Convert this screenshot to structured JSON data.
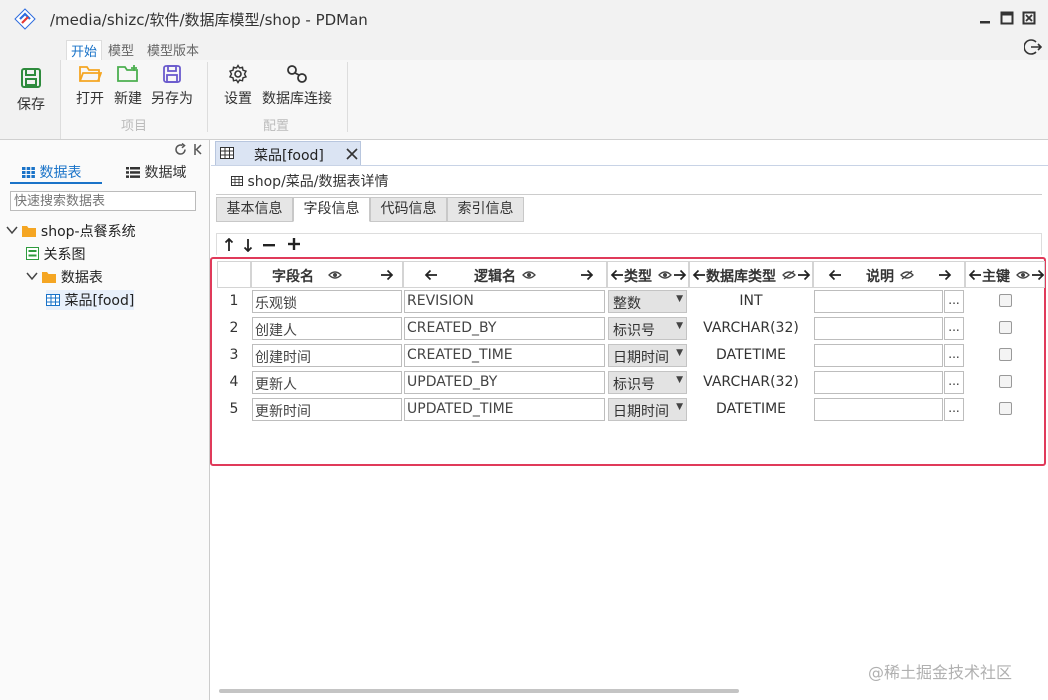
{
  "window": {
    "title": "/media/shizc/软件/数据库模型/shop - PDMan"
  },
  "ribbon": {
    "tabs": [
      "开始",
      "模型",
      "模型版本"
    ],
    "save_label": "保存",
    "open_label": "打开",
    "new_label": "新建",
    "saveas_label": "另存为",
    "project_group": "项目",
    "settings_label": "设置",
    "dbconn_label": "数据库连接",
    "config_group": "配置"
  },
  "sidebar": {
    "tab_tables": "数据表",
    "tab_domains": "数据域",
    "search_placeholder": "快速搜索数据表",
    "tree": {
      "project": "shop-点餐系统",
      "relation": "关系图",
      "folder": "数据表",
      "table": "菜品[food]"
    }
  },
  "editor": {
    "doc_tab": "菜品[food]",
    "breadcrumb": "shop/菜品/数据表详情",
    "sub_tabs": [
      "基本信息",
      "字段信息",
      "代码信息",
      "索引信息"
    ],
    "columns": {
      "field_name": "字段名",
      "logical_name": "逻辑名",
      "type": "类型",
      "db_type": "数据库类型",
      "comment": "说明",
      "primary_key": "主键"
    },
    "rows": [
      {
        "num": "1",
        "field": "乐观锁",
        "logic": "REVISION",
        "type": "整数",
        "db": "INT"
      },
      {
        "num": "2",
        "field": "创建人",
        "logic": "CREATED_BY",
        "type": "标识号",
        "db": "VARCHAR(32)"
      },
      {
        "num": "3",
        "field": "创建时间",
        "logic": "CREATED_TIME",
        "type": "日期时间",
        "db": "DATETIME"
      },
      {
        "num": "4",
        "field": "更新人",
        "logic": "UPDATED_BY",
        "type": "标识号",
        "db": "VARCHAR(32)"
      },
      {
        "num": "5",
        "field": "更新时间",
        "logic": "UPDATED_TIME",
        "type": "日期时间",
        "db": "DATETIME"
      }
    ],
    "more_btn": "..."
  },
  "watermark": "@稀土掘金技术社区",
  "colors": {
    "accent": "#1a73c8",
    "highlight": "#e03a5a",
    "folder": "#f5a623"
  }
}
